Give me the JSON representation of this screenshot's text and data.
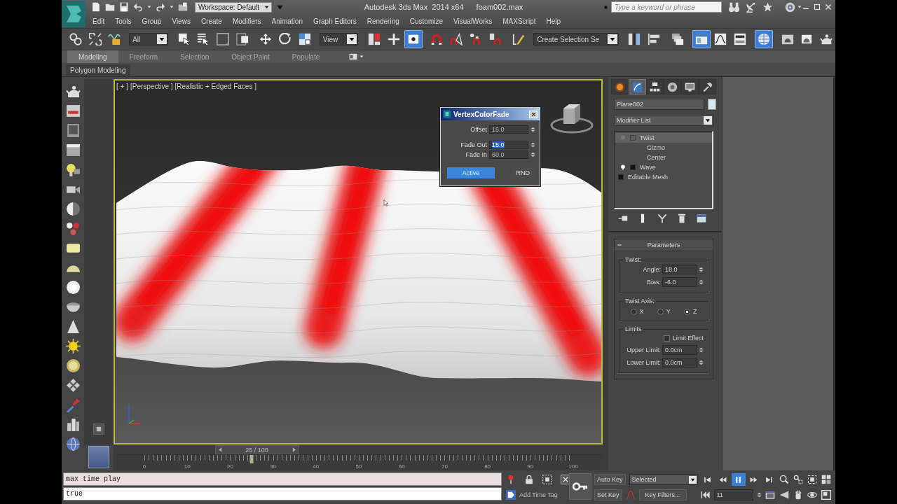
{
  "title_bar": {
    "workspace": "Workspace: Default",
    "app_title": "Autodesk 3ds Max  2014 x64",
    "file_name": "foam002.max",
    "search": {
      "placeholder": "Type a keyword or phrase"
    }
  },
  "menu": [
    "Edit",
    "Tools",
    "Group",
    "Views",
    "Create",
    "Modifiers",
    "Animation",
    "Graph Editors",
    "Rendering",
    "Customize",
    "VisualWorks",
    "MAXScript",
    "Help"
  ],
  "main_toolbar": [
    {
      "kind": "link",
      "on": false
    },
    {
      "kind": "unlink",
      "on": false
    },
    {
      "kind": "bind",
      "on": false
    },
    {
      "kind": "dropdown",
      "value": "All"
    },
    {
      "kind": "select",
      "on": false
    },
    {
      "kind": "select-by-name",
      "on": false
    },
    {
      "kind": "region",
      "on": false
    },
    {
      "kind": "crossing",
      "on": false
    },
    {
      "kind": "move",
      "on": false
    },
    {
      "kind": "rotate",
      "on": false
    },
    {
      "kind": "scale",
      "on": false
    },
    {
      "kind": "dropdown",
      "value": "View"
    },
    {
      "kind": "pivot",
      "on": false
    },
    {
      "kind": "manipulate",
      "on": false
    },
    {
      "kind": "shortcut",
      "on": true
    },
    {
      "kind": "snap",
      "on": false
    },
    {
      "kind": "angle-snap",
      "on": false
    },
    {
      "kind": "percent-snap",
      "on": false
    },
    {
      "kind": "spinner-snap",
      "on": false
    },
    {
      "kind": "named-selection",
      "on": false
    },
    {
      "kind": "dropdown",
      "value": "Create Selection Se"
    },
    {
      "kind": "mirror",
      "on": false
    },
    {
      "kind": "align",
      "on": false
    },
    {
      "kind": "layers",
      "on": false
    },
    {
      "kind": "ribbon",
      "on": true
    },
    {
      "kind": "curve-editor",
      "on": false
    },
    {
      "kind": "schematic",
      "on": false
    },
    {
      "kind": "material",
      "on": true
    },
    {
      "kind": "render-setup",
      "on": false
    },
    {
      "kind": "frame-window",
      "on": false
    },
    {
      "kind": "render",
      "on": false
    }
  ],
  "ribbon": {
    "tabs": [
      {
        "label": "Modeling",
        "selected": true
      },
      {
        "label": "Freeform",
        "selected": false
      },
      {
        "label": "Selection",
        "selected": false
      },
      {
        "label": "Object Paint",
        "selected": false
      },
      {
        "label": "Populate",
        "selected": false
      }
    ],
    "panel": "Polygon Modeling"
  },
  "viewport": {
    "labels": [
      "[ + ]",
      "[Perspective ]",
      "[Realistic + Edged Faces ]"
    ]
  },
  "dialog": {
    "title": "VertexColorFade",
    "fields": [
      {
        "label": "Offset",
        "value": "15.0",
        "selected": false
      },
      {
        "label": "Fade Out",
        "value": "15.0",
        "selected": true
      },
      {
        "label": "Fade In",
        "value": "60.0",
        "selected": false
      }
    ],
    "buttons": [
      {
        "label": "Active",
        "on": true
      },
      {
        "label": "RND",
        "on": false
      }
    ]
  },
  "command_panel": {
    "tabs": [
      {
        "kind": "create",
        "selected": false
      },
      {
        "kind": "modify",
        "selected": true
      },
      {
        "kind": "hierarchy",
        "selected": false
      },
      {
        "kind": "motion",
        "selected": false
      },
      {
        "kind": "display",
        "selected": false
      },
      {
        "kind": "utilities",
        "selected": false
      }
    ],
    "object_name": "Plane002",
    "modifier_list": "Modifier List",
    "stack": [
      {
        "name": "Twist",
        "kind": "modifier",
        "on": false,
        "selected": true,
        "expanded": true,
        "children": [
          {
            "name": "Gizmo",
            "selected": false
          },
          {
            "name": "Center",
            "selected": false
          }
        ]
      },
      {
        "name": "Wave",
        "kind": "modifier",
        "on": true,
        "selected": false,
        "expanded": false
      },
      {
        "name": "Editable Mesh",
        "kind": "base",
        "selected": false,
        "expanded": false
      }
    ],
    "rollout": {
      "title": "Parameters",
      "groups": [
        {
          "kind": "spinners",
          "title": "Twist:",
          "rows": [
            {
              "label": "Angle:",
              "value": "18.0"
            },
            {
              "label": "Bias:",
              "value": "-6.0"
            }
          ]
        },
        {
          "kind": "radios",
          "title": "Twist Axis:",
          "options": [
            {
              "label": "X",
              "selected": false
            },
            {
              "label": "Y",
              "selected": false
            },
            {
              "label": "Z",
              "selected": true
            }
          ]
        },
        {
          "kind": "limits",
          "title": "Limits",
          "checkbox": {
            "label": "Limit Effect",
            "checked": false
          },
          "rows": [
            {
              "label": "Upper Limit:",
              "value": "0.0cm"
            },
            {
              "label": "Lower Limit:",
              "value": "0.0cm"
            }
          ]
        }
      ]
    }
  },
  "time_slider": {
    "label": "25 / 100",
    "level": 0.25
  },
  "track_bar": {
    "ticks": [
      "0",
      "10",
      "20",
      "30",
      "40",
      "50",
      "60",
      "70",
      "80",
      "90",
      "100"
    ]
  },
  "listener": [
    {
      "kind": "input",
      "text": "max time play"
    },
    {
      "kind": "output",
      "text": "true"
    }
  ],
  "animation_controls": {
    "add_time_tag": "Add Time Tag",
    "auto_key": {
      "label": "Auto Key",
      "on": false
    },
    "key_mode": "Selected",
    "set_key": {
      "label": "Set Key",
      "on": false
    },
    "key_filters": "Key Filters...",
    "playback": [
      {
        "kind": "start",
        "on": false
      },
      {
        "kind": "prev",
        "on": false
      },
      {
        "kind": "play",
        "on": true
      },
      {
        "kind": "next",
        "on": false
      },
      {
        "kind": "end",
        "on": false
      }
    ],
    "frame": "11"
  }
}
